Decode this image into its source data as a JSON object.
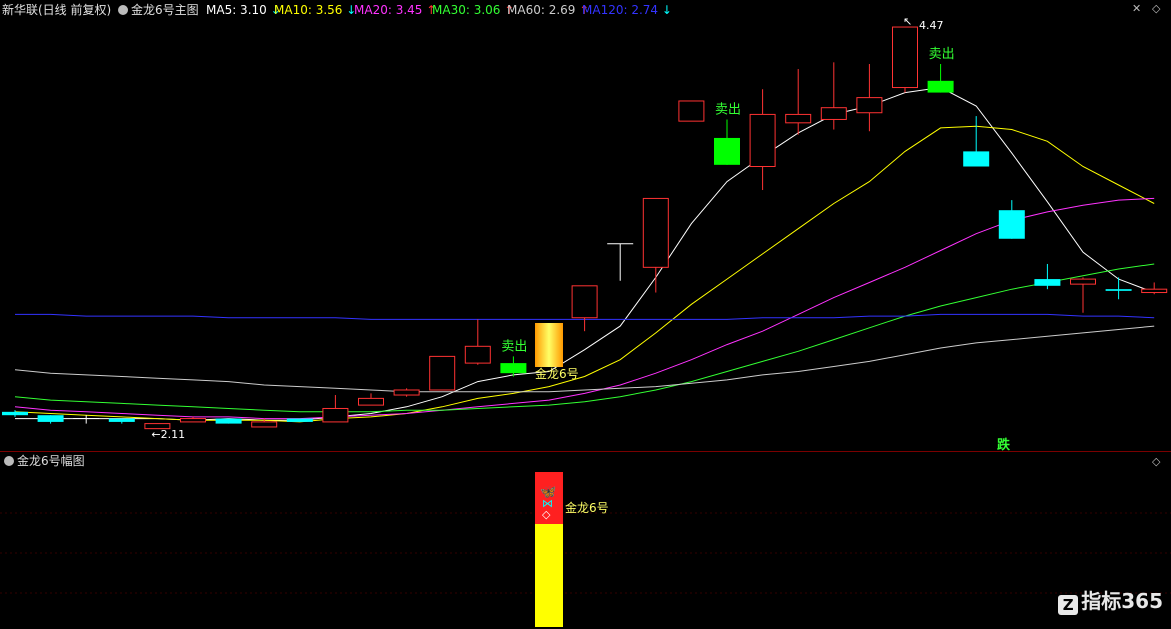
{
  "header": {
    "stock": "新华联(日线 前复权)",
    "indicator": "金龙6号主图",
    "ma": [
      {
        "label": "MA5: 3.10",
        "arrow": "↓",
        "color": "#ffffff",
        "arrow_color": "#00ffff"
      },
      {
        "label": "MA10: 3.56",
        "arrow": "↓",
        "color": "#ffff00",
        "arrow_color": "#00ffff"
      },
      {
        "label": "MA20: 3.45",
        "arrow": "↑",
        "color": "#ff33ff",
        "arrow_color": "#ff3333"
      },
      {
        "label": "MA30: 3.06",
        "arrow": "↑",
        "color": "#33ff33",
        "arrow_color": "#ff3333"
      },
      {
        "label": "MA60: 2.69",
        "arrow": "↑",
        "color": "#cccccc",
        "arrow_color": "#ff3333"
      },
      {
        "label": "MA120: 2.74",
        "arrow": "↓",
        "color": "#3333ff",
        "arrow_color": "#00ffff"
      }
    ],
    "close_icon": "close-icon",
    "collapse_icon": "diamond-icon"
  },
  "main": {
    "low_label": "2.11",
    "high_label": "4.47",
    "sell_labels": [
      "卖出",
      "卖出",
      "卖出"
    ],
    "signal_label": "金龙6号",
    "drop_label": "跌"
  },
  "sub": {
    "title": "金龙6号幅图",
    "signal_label": "金龙6号"
  },
  "watermark": {
    "icon": "Z",
    "text": "指标365"
  },
  "colors": {
    "up": "#ff3333",
    "down_cyan": "#00ffff",
    "sell_green": "#00ff00",
    "bg": "#000000",
    "signal_yellow": "#ffff00",
    "signal_red": "#ff2020"
  },
  "chart_data": {
    "type": "candlestick",
    "candles": [
      {
        "o": 2.18,
        "c": 2.16,
        "h": 2.19,
        "l": 2.15,
        "color": "cyan"
      },
      {
        "o": 2.16,
        "c": 2.12,
        "h": 2.16,
        "l": 2.11,
        "color": "cyan"
      },
      {
        "o": 2.14,
        "c": 2.14,
        "h": 2.16,
        "l": 2.11,
        "color": "white"
      },
      {
        "o": 2.14,
        "c": 2.12,
        "h": 2.14,
        "l": 2.11,
        "color": "cyan"
      },
      {
        "o": 2.08,
        "c": 2.11,
        "h": 2.11,
        "l": 2.08,
        "color": "red"
      },
      {
        "o": 2.12,
        "c": 2.14,
        "h": 2.15,
        "l": 2.12,
        "color": "red"
      },
      {
        "o": 2.14,
        "c": 2.11,
        "h": 2.14,
        "l": 2.11,
        "color": "cyan"
      },
      {
        "o": 2.09,
        "c": 2.12,
        "h": 2.14,
        "l": 2.09,
        "color": "red"
      },
      {
        "o": 2.14,
        "c": 2.12,
        "h": 2.14,
        "l": 2.12,
        "color": "cyan"
      },
      {
        "o": 2.12,
        "c": 2.2,
        "h": 2.28,
        "l": 2.12,
        "color": "red"
      },
      {
        "o": 2.22,
        "c": 2.26,
        "h": 2.29,
        "l": 2.22,
        "color": "red"
      },
      {
        "o": 2.28,
        "c": 2.31,
        "h": 2.32,
        "l": 2.27,
        "color": "red"
      },
      {
        "o": 2.31,
        "c": 2.51,
        "h": 2.51,
        "l": 2.31,
        "color": "red"
      },
      {
        "o": 2.47,
        "c": 2.57,
        "h": 2.73,
        "l": 2.46,
        "color": "red"
      },
      {
        "o": 2.47,
        "c": 2.41,
        "h": 2.51,
        "l": 2.39,
        "color": "green"
      },
      {
        "o": 2.47,
        "c": 2.47,
        "h": 2.47,
        "l": 2.47,
        "color": "none"
      },
      {
        "o": 2.74,
        "c": 2.93,
        "h": 2.93,
        "l": 2.66,
        "color": "red"
      },
      {
        "o": 3.18,
        "c": 3.18,
        "h": 3.18,
        "l": 2.96,
        "color": "white"
      },
      {
        "o": 3.04,
        "c": 3.45,
        "h": 3.45,
        "l": 2.89,
        "color": "red"
      },
      {
        "o": 3.91,
        "c": 4.03,
        "h": 4.03,
        "l": 3.91,
        "color": "red"
      },
      {
        "o": 3.81,
        "c": 3.65,
        "h": 3.92,
        "l": 3.65,
        "color": "green"
      },
      {
        "o": 3.64,
        "c": 3.95,
        "h": 4.1,
        "l": 3.5,
        "color": "red"
      },
      {
        "o": 3.9,
        "c": 3.95,
        "h": 4.22,
        "l": 3.83,
        "color": "red"
      },
      {
        "o": 3.92,
        "c": 3.99,
        "h": 4.26,
        "l": 3.86,
        "color": "red"
      },
      {
        "o": 3.96,
        "c": 4.05,
        "h": 4.25,
        "l": 3.85,
        "color": "red"
      },
      {
        "o": 4.11,
        "c": 4.47,
        "h": 4.47,
        "l": 4.08,
        "color": "red"
      },
      {
        "o": 4.15,
        "c": 4.08,
        "h": 4.25,
        "l": 4.08,
        "color": "green"
      },
      {
        "o": 3.73,
        "c": 3.64,
        "h": 3.94,
        "l": 3.64,
        "color": "cyan"
      },
      {
        "o": 3.38,
        "c": 3.21,
        "h": 3.44,
        "l": 3.21,
        "color": "cyan"
      },
      {
        "o": 2.97,
        "c": 2.93,
        "h": 3.06,
        "l": 2.91,
        "color": "cyan"
      },
      {
        "o": 2.97,
        "c": 2.94,
        "h": 2.98,
        "l": 2.77,
        "color": "red"
      },
      {
        "o": 2.91,
        "c": 2.9,
        "h": 2.98,
        "l": 2.85,
        "color": "cyan"
      },
      {
        "o": 2.89,
        "c": 2.91,
        "h": 2.95,
        "l": 2.88,
        "color": "red"
      }
    ],
    "signal_bar_index": 15,
    "sell_indices": [
      14,
      20,
      26
    ],
    "ma_series": [
      {
        "name": "MA5",
        "color": "#ffffff",
        "values": [
          2.14,
          2.14,
          2.14,
          2.14,
          2.14,
          2.13,
          2.14,
          2.13,
          2.13,
          2.15,
          2.17,
          2.21,
          2.27,
          2.36,
          2.4,
          2.42,
          2.55,
          2.69,
          2.98,
          3.3,
          3.55,
          3.7,
          3.84,
          3.95,
          4.0,
          4.08,
          4.11,
          4.0,
          3.72,
          3.43,
          3.13,
          2.97,
          2.89
        ]
      },
      {
        "name": "MA10",
        "color": "#ffff00",
        "values": [
          2.18,
          2.17,
          2.16,
          2.15,
          2.14,
          2.13,
          2.13,
          2.13,
          2.12,
          2.14,
          2.15,
          2.17,
          2.21,
          2.26,
          2.29,
          2.33,
          2.39,
          2.49,
          2.65,
          2.82,
          2.97,
          3.12,
          3.27,
          3.42,
          3.55,
          3.73,
          3.87,
          3.88,
          3.86,
          3.79,
          3.64,
          3.53,
          3.42
        ]
      },
      {
        "name": "MA20",
        "color": "#ff33ff",
        "values": [
          2.21,
          2.19,
          2.18,
          2.17,
          2.16,
          2.15,
          2.15,
          2.14,
          2.14,
          2.15,
          2.16,
          2.17,
          2.19,
          2.21,
          2.23,
          2.25,
          2.29,
          2.34,
          2.41,
          2.49,
          2.58,
          2.66,
          2.76,
          2.86,
          2.95,
          3.04,
          3.14,
          3.24,
          3.32,
          3.37,
          3.41,
          3.44,
          3.45
        ]
      },
      {
        "name": "MA30",
        "color": "#33ff33",
        "values": [
          2.27,
          2.25,
          2.24,
          2.23,
          2.22,
          2.21,
          2.2,
          2.19,
          2.18,
          2.18,
          2.18,
          2.19,
          2.19,
          2.2,
          2.21,
          2.22,
          2.24,
          2.27,
          2.31,
          2.36,
          2.42,
          2.48,
          2.54,
          2.61,
          2.68,
          2.75,
          2.81,
          2.86,
          2.91,
          2.95,
          2.99,
          3.03,
          3.06
        ]
      },
      {
        "name": "MA60",
        "color": "#cccccc",
        "values": [
          2.43,
          2.41,
          2.4,
          2.39,
          2.38,
          2.37,
          2.36,
          2.34,
          2.33,
          2.32,
          2.31,
          2.3,
          2.3,
          2.3,
          2.3,
          2.3,
          2.31,
          2.32,
          2.33,
          2.35,
          2.37,
          2.4,
          2.42,
          2.45,
          2.48,
          2.52,
          2.56,
          2.59,
          2.61,
          2.63,
          2.65,
          2.67,
          2.69
        ]
      },
      {
        "name": "MA120",
        "color": "#3333ff",
        "values": [
          2.76,
          2.76,
          2.75,
          2.75,
          2.75,
          2.75,
          2.74,
          2.74,
          2.74,
          2.74,
          2.73,
          2.73,
          2.73,
          2.73,
          2.73,
          2.73,
          2.73,
          2.73,
          2.73,
          2.73,
          2.73,
          2.74,
          2.74,
          2.74,
          2.75,
          2.75,
          2.76,
          2.76,
          2.76,
          2.76,
          2.75,
          2.75,
          2.74
        ]
      }
    ]
  }
}
